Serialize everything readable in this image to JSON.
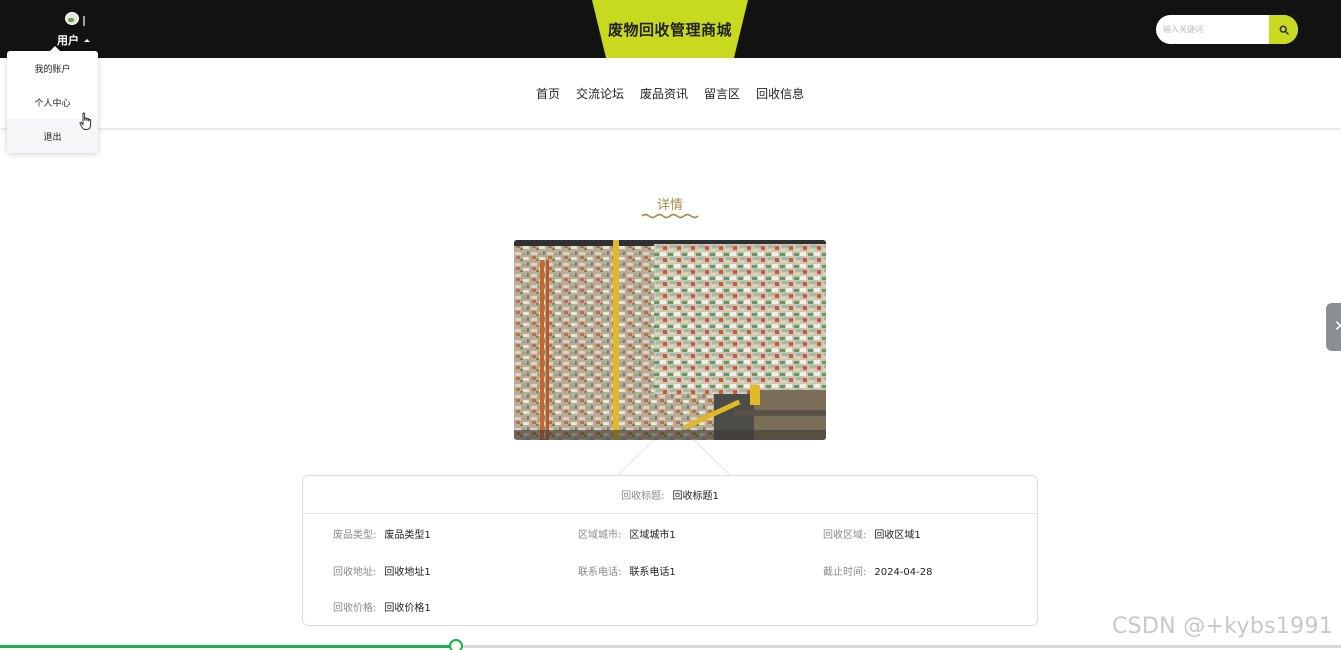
{
  "header": {
    "site_title": "废物回收管理商城",
    "user_label": "用户",
    "search_placeholder": "输入关键词"
  },
  "nav": {
    "items": [
      {
        "label": "首页"
      },
      {
        "label": "交流论坛"
      },
      {
        "label": "废品资讯"
      },
      {
        "label": "留言区"
      },
      {
        "label": "回收信息"
      }
    ]
  },
  "user_menu": {
    "items": [
      {
        "label": "我的账户"
      },
      {
        "label": "个人中心"
      },
      {
        "label": "退出"
      }
    ]
  },
  "detail": {
    "heading": "详情",
    "title_label": "回收标题:",
    "title_value": "回收标题1",
    "fields": [
      {
        "label": "废品类型:",
        "value": "废品类型1"
      },
      {
        "label": "区域城市:",
        "value": "区域城市1"
      },
      {
        "label": "回收区域:",
        "value": "回收区域1"
      },
      {
        "label": "回收地址:",
        "value": "回收地址1"
      },
      {
        "label": "联系电话:",
        "value": "联系电话1"
      },
      {
        "label": "截止时间:",
        "value": "2024-04-28"
      },
      {
        "label": "回收价格:",
        "value": "回收价格1"
      }
    ]
  },
  "video_progress": 0.34,
  "watermark": "CSDN @+kybs1991",
  "colors": {
    "brand": "#c7da1f",
    "header_bg": "#121212",
    "heading_accent": "#a39149",
    "progress": "#16b34a"
  },
  "icons": {
    "search": "search-icon",
    "side_tab": "close-icon",
    "cursor": "hand-pointer-icon"
  }
}
